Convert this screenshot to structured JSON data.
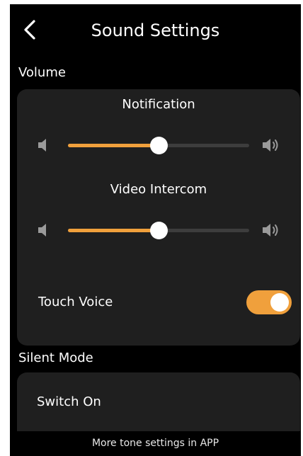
{
  "header": {
    "title": "Sound Settings",
    "back_icon": "chevron-left-icon"
  },
  "volume": {
    "section_label": "Volume",
    "sliders": [
      {
        "label": "Notification",
        "level_fraction": 0.5,
        "low_icon": "speaker-low-icon",
        "high_icon": "speaker-high-icon"
      },
      {
        "label": "Video Intercom",
        "level_fraction": 0.5,
        "low_icon": "speaker-low-icon",
        "high_icon": "speaker-high-icon"
      }
    ],
    "touch_voice": {
      "label": "Touch Voice",
      "enabled": true
    }
  },
  "silent_mode": {
    "section_label": "Silent Mode",
    "switch_label": "Switch On"
  },
  "footer": {
    "text": "More tone settings in APP"
  },
  "colors": {
    "background": "#000000",
    "card": "#1f1f1f",
    "accent": "#f0a03c",
    "track": "#3d3d3d",
    "text": "#ffffff"
  }
}
